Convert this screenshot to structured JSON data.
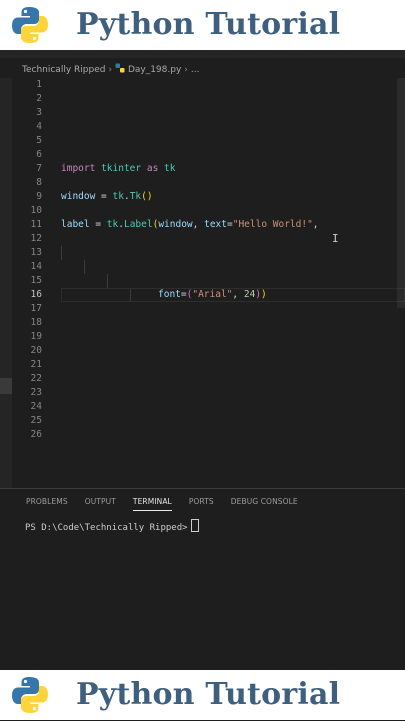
{
  "banner": {
    "title": "Python Tutorial",
    "logo_icon": "python-logo-icon"
  },
  "breadcrumb": {
    "folder": "Technically Ripped",
    "file": "Day_198.py",
    "more": "..."
  },
  "editor": {
    "line_numbers": [
      "1",
      "2",
      "3",
      "4",
      "5",
      "6",
      "7",
      "8",
      "9",
      "10",
      "11",
      "12",
      "13",
      "14",
      "15",
      "16",
      "17",
      "18",
      "19",
      "20",
      "21",
      "22",
      "23",
      "24",
      "25",
      "26"
    ],
    "active_line": "16",
    "code": {
      "l6": {
        "kw_import": "import",
        "module": "tkinter",
        "kw_as": "as",
        "alias": "tk"
      },
      "l8": {
        "var": "window",
        "eq": " = ",
        "mod": "tk",
        "dot": ".",
        "cls": "Tk",
        "paren": "()"
      },
      "l10": {
        "var": "label",
        "eq": " = ",
        "mod": "tk",
        "dot": ".",
        "cls": "Label",
        "open": "(",
        "arg1": "window",
        "comma": ", ",
        "kwarg": "text",
        "assign": "=",
        "str": "\"Hello World!\"",
        "end": ","
      },
      "l11": {
        "kwarg": "font",
        "assign": "=",
        "open": "(",
        "str": "\"Arial\"",
        "comma": ", ",
        "num": "24",
        "close_inner": ")",
        "close_outer": ")"
      }
    }
  },
  "panel": {
    "tabs": [
      "PROBLEMS",
      "OUTPUT",
      "TERMINAL",
      "PORTS",
      "DEBUG CONSOLE"
    ],
    "active_tab": "TERMINAL",
    "prompt": "PS D:\\Code\\Technically Ripped>"
  },
  "colors": {
    "banner_text": "#3e5f7e",
    "editor_bg": "#1e1e1e",
    "keyword": "#c586c0",
    "string": "#ce9178"
  }
}
